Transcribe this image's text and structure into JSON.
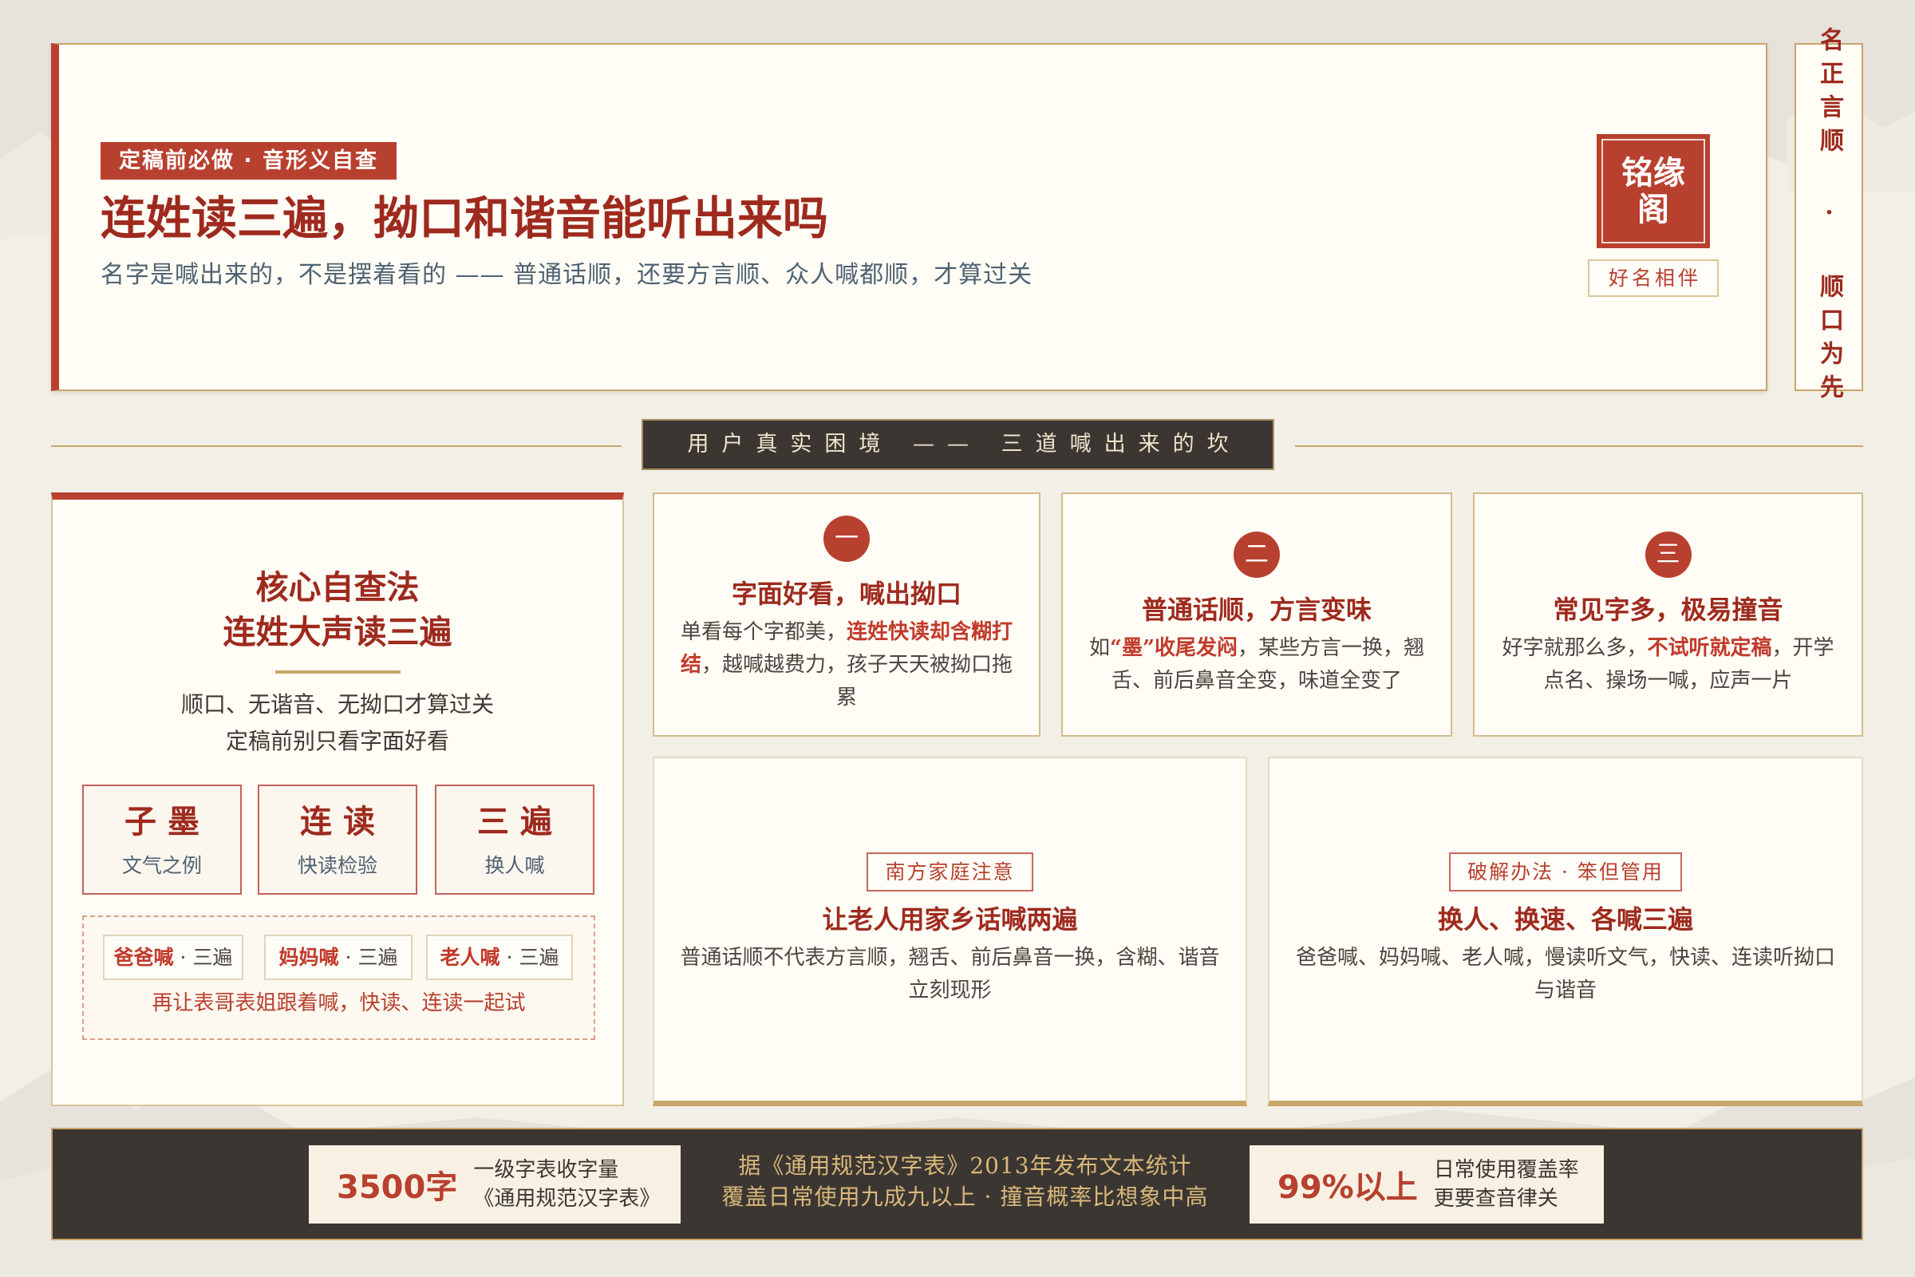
{
  "colors": {
    "red": "#b8402e",
    "deep_red": "#9e2a1e",
    "gold": "#c9a56a",
    "dark": "#3b3632",
    "cream": "#fffdf6",
    "slate": "#4f6272",
    "highlight": "#c23a2b"
  },
  "header": {
    "tag": "定稿前必做 · 音形义自查",
    "title": "连姓读三遍，拗口和谐音能听出来吗",
    "subtitle": "名字是喊出来的，不是摆着看的 —— 普通话顺，还要方言顺、众人喊都顺，才算过关",
    "seal_line1": "铭缘",
    "seal_line2": "阁",
    "motto": "好名相伴"
  },
  "side_banner": "名正言顺 · 顺口为先",
  "section_title": "用户真实困境 —— 三道喊出来的坎",
  "method": {
    "title_line1": "核心自查法",
    "title_line2": "连姓大声读三遍",
    "desc_line1": "顺口、无谐音、无拗口才算过关",
    "desc_line2": "定稿前别只看字面好看",
    "boxes": [
      {
        "big": "子 墨",
        "small": "文气之例"
      },
      {
        "big": "连 读",
        "small": "快读检验"
      },
      {
        "big": "三 遍",
        "small": "换人喊"
      }
    ],
    "chips": [
      {
        "who": "爸爸喊",
        "times": "· 三遍"
      },
      {
        "who": "妈妈喊",
        "times": "· 三遍"
      },
      {
        "who": "老人喊",
        "times": "· 三遍"
      }
    ],
    "note": "再让表哥表姐跟着喊，快读、连读一起试"
  },
  "problems": [
    {
      "num": "一",
      "title": "字面好看，喊出拗口",
      "text_before": "单看每个字都美，",
      "text_highlight": "连姓快读却含糊打结",
      "text_after": "，越喊越费力，孩子天天被拗口拖累"
    },
    {
      "num": "二",
      "title": "普通话顺，方言变味",
      "text_before": "如",
      "text_highlight": "“墨”收尾发闷",
      "text_after": "，某些方言一换，翘舌、前后鼻音全变，味道全变了"
    },
    {
      "num": "三",
      "title": "常见字多，极易撞音",
      "text_before": "好字就那么多，",
      "text_highlight": "不试听就定稿",
      "text_after": "，开学点名、操场一喊，应声一片"
    }
  ],
  "solutions": [
    {
      "tag": "南方家庭注意",
      "title": "让老人用家乡话喊两遍",
      "text": "普通话顺不代表方言顺，翘舌、前后鼻音一换，含糊、谐音立刻现形"
    },
    {
      "tag": "破解办法 · 笨但管用",
      "title": "换人、换速、各喊三遍",
      "text": "爸爸喊、妈妈喊、老人喊，慢读听文气，快读、连读听拗口与谐音"
    }
  ],
  "footer": {
    "stat1": {
      "value": "3500字",
      "label1": "一级字表收字量",
      "label2": "《通用规范汉字表》"
    },
    "center_line1": "据《通用规范汉字表》2013年发布文本统计",
    "center_line2": "覆盖日常使用九成九以上 · 撞音概率比想象中高",
    "stat2": {
      "value": "99%以上",
      "label1": "日常使用覆盖率",
      "label2": "更要查音律关"
    }
  }
}
